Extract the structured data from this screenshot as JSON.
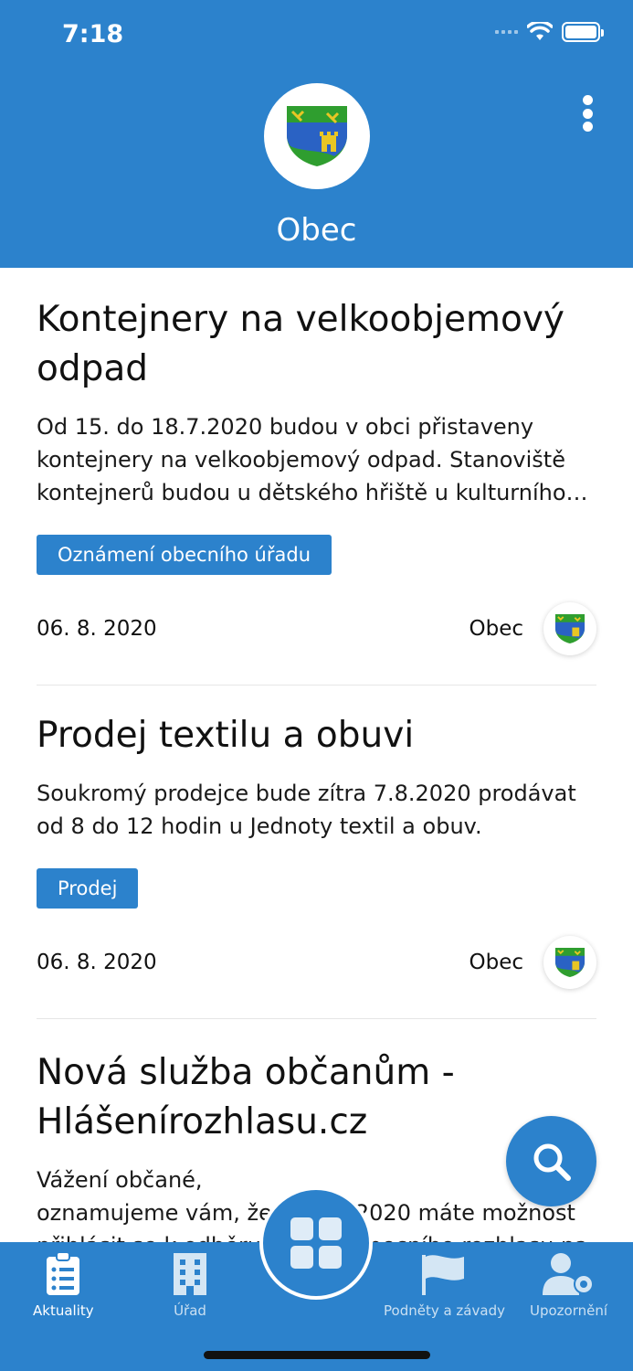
{
  "status": {
    "time": "7:18"
  },
  "header": {
    "title": "Obec"
  },
  "news": [
    {
      "title": "Kontejnery na velkoobjemový odpad",
      "text": "Od 15. do 18.7.2020 budou v obci přistaveny kontejnery na velkoobjemový odpad. Stanoviště kontejnerů budou u dětského hřiště u kulturního…",
      "tag": "Oznámení obecního úřadu",
      "date": "06. 8. 2020",
      "source": "Obec"
    },
    {
      "title": "Prodej textilu a obuvi",
      "text": "Soukromý prodejce bude zítra 7.8.2020 prodávat od 8 do 12 hodin u Jednoty textil a obuv.",
      "tag": "Prodej",
      "date": "06. 8. 2020",
      "source": "Obec"
    },
    {
      "title": "Nová služba občanům - Hlášenírozhlasu.cz",
      "text": "Vážení občané,\noznamujeme vám, že od 1.8.2020 máte možnost přihlásit se k odběru zpráv z obecního rozhlasu na hlasenirozhlasu.cz"
    }
  ],
  "nav": {
    "aktuality": "Aktuality",
    "urad": "Úřad",
    "podnety": "Podněty a závady",
    "upozorneni": "Upozornění"
  },
  "colors": {
    "primary": "#2c82cc",
    "shield_green": "#2f9e2f",
    "shield_blue": "#2a62c4",
    "shield_gold": "#e8c624"
  }
}
